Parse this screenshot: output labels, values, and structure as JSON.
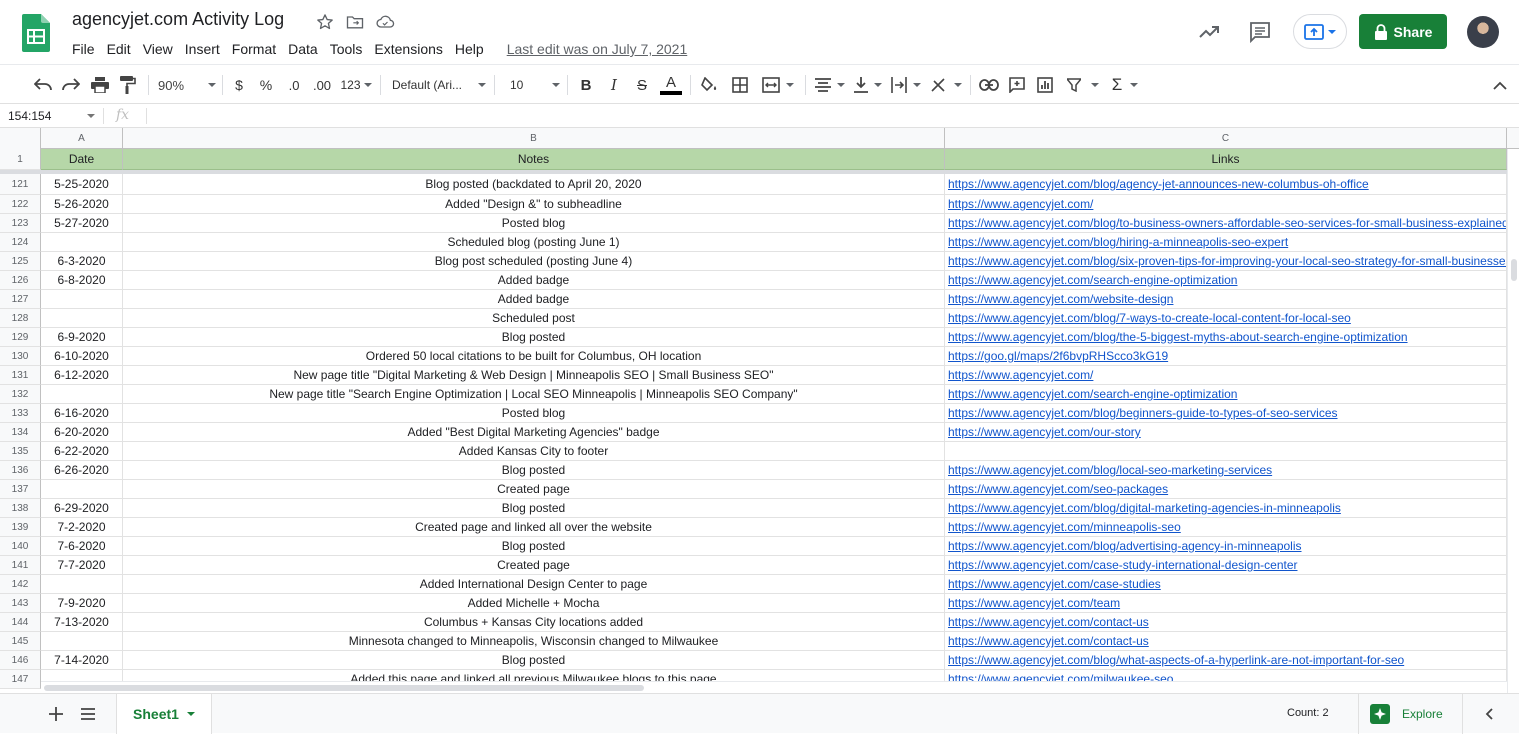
{
  "header": {
    "title": "agencyjet.com Activity Log",
    "menu": [
      "File",
      "Edit",
      "View",
      "Insert",
      "Format",
      "Data",
      "Tools",
      "Extensions",
      "Help"
    ],
    "last_edit": "Last edit was on July 7, 2021",
    "share_label": "Share",
    "brand_color": "#188038"
  },
  "toolbar": {
    "zoom": "90%",
    "currency": "$",
    "percent": "%",
    "decrease_decimal": ".0",
    "increase_decimal": ".00",
    "more_formats": "123",
    "font": "Default (Ari...",
    "font_size": "10"
  },
  "formula_bar": {
    "name_box": "154:154",
    "fx": "fx",
    "value": ""
  },
  "columns": [
    "A",
    "B",
    "C"
  ],
  "header_row": {
    "row": "1",
    "cells": [
      "Date",
      "Notes",
      "Links"
    ],
    "fill": "#b6d7a8"
  },
  "rows": [
    {
      "row": "121",
      "date": "5-25-2020",
      "note": "Blog posted (backdated to April 20, 2020",
      "link": "https://www.agencyjet.com/blog/agency-jet-announces-new-columbus-oh-office"
    },
    {
      "row": "122",
      "date": "5-26-2020",
      "note": "Added \"Design &\" to subheadline",
      "link": "https://www.agencyjet.com/"
    },
    {
      "row": "123",
      "date": "5-27-2020",
      "note": "Posted blog",
      "link": "https://www.agencyjet.com/blog/to-business-owners-affordable-seo-services-for-small-business-explained"
    },
    {
      "row": "124",
      "date": "",
      "note": "Scheduled blog (posting June 1)",
      "link": "https://www.agencyjet.com/blog/hiring-a-minneapolis-seo-expert"
    },
    {
      "row": "125",
      "date": "6-3-2020",
      "note": "Blog post scheduled (posting June 4)",
      "link": "https://www.agencyjet.com/blog/six-proven-tips-for-improving-your-local-seo-strategy-for-small-businesses"
    },
    {
      "row": "126",
      "date": "6-8-2020",
      "note": "Added badge",
      "link": "https://www.agencyjet.com/search-engine-optimization"
    },
    {
      "row": "127",
      "date": "",
      "note": "Added badge",
      "link": "https://www.agencyjet.com/website-design"
    },
    {
      "row": "128",
      "date": "",
      "note": "Scheduled post",
      "link": "https://www.agencyjet.com/blog/7-ways-to-create-local-content-for-local-seo"
    },
    {
      "row": "129",
      "date": "6-9-2020",
      "note": "Blog posted",
      "link": "https://www.agencyjet.com/blog/the-5-biggest-myths-about-search-engine-optimization"
    },
    {
      "row": "130",
      "date": "6-10-2020",
      "note": "Ordered 50 local citations to be built for Columbus, OH location",
      "link": "https://goo.gl/maps/2f6bvpRHScco3kG19"
    },
    {
      "row": "131",
      "date": "6-12-2020",
      "note": "New page title \"Digital Marketing & Web Design | Minneapolis SEO | Small Business SEO\"",
      "link": "https://www.agencyjet.com/"
    },
    {
      "row": "132",
      "date": "",
      "note": "New page title \"Search Engine Optimization | Local SEO Minneapolis | Minneapolis SEO Company\"",
      "link": "https://www.agencyjet.com/search-engine-optimization"
    },
    {
      "row": "133",
      "date": "6-16-2020",
      "note": "Posted blog",
      "link": "https://www.agencyjet.com/blog/beginners-guide-to-types-of-seo-services"
    },
    {
      "row": "134",
      "date": "6-20-2020",
      "note": "Added \"Best Digital Marketing Agencies\" badge",
      "link": "https://www.agencyjet.com/our-story"
    },
    {
      "row": "135",
      "date": "6-22-2020",
      "note": "Added Kansas City to footer",
      "link": ""
    },
    {
      "row": "136",
      "date": "6-26-2020",
      "note": "Blog posted",
      "link": "https://www.agencyjet.com/blog/local-seo-marketing-services"
    },
    {
      "row": "137",
      "date": "",
      "note": "Created page",
      "link": "https://www.agencyjet.com/seo-packages"
    },
    {
      "row": "138",
      "date": "6-29-2020",
      "note": "Blog posted",
      "link": "https://www.agencyjet.com/blog/digital-marketing-agencies-in-minneapolis"
    },
    {
      "row": "139",
      "date": "7-2-2020",
      "note": "Created page and linked all over the website",
      "link": "https://www.agencyjet.com/minneapolis-seo"
    },
    {
      "row": "140",
      "date": "7-6-2020",
      "note": "Blog posted",
      "link": "https://www.agencyjet.com/blog/advertising-agency-in-minneapolis"
    },
    {
      "row": "141",
      "date": "7-7-2020",
      "note": "Created page",
      "link": "https://www.agencyjet.com/case-study-international-design-center"
    },
    {
      "row": "142",
      "date": "",
      "note": "Added International Design Center to page",
      "link": "https://www.agencyjet.com/case-studies"
    },
    {
      "row": "143",
      "date": "7-9-2020",
      "note": "Added Michelle + Mocha",
      "link": "https://www.agencyjet.com/team"
    },
    {
      "row": "144",
      "date": "7-13-2020",
      "note": "Columbus + Kansas City locations added",
      "link": "https://www.agencyjet.com/contact-us"
    },
    {
      "row": "145",
      "date": "",
      "note": "Minnesota changed to Minneapolis, Wisconsin changed to Milwaukee",
      "link": "https://www.agencyjet.com/contact-us"
    },
    {
      "row": "146",
      "date": "7-14-2020",
      "note": "Blog posted",
      "link": "https://www.agencyjet.com/blog/what-aspects-of-a-hyperlink-are-not-important-for-seo"
    },
    {
      "row": "147",
      "date": "",
      "note": "Added this page and linked all previous Milwaukee blogs to this page",
      "link": "https://www.agencyjet.com/milwaukee-seo"
    }
  ],
  "bottom_bar": {
    "sheet_name": "Sheet1",
    "count": "Count: 2",
    "explore_label": "Explore"
  },
  "icons": [
    "sheets-logo-icon",
    "star-icon",
    "move-to-folder-icon",
    "cloud-saved-icon",
    "activity-trend-icon",
    "comments-icon",
    "present-icon",
    "lock-icon",
    "avatar",
    "undo-icon",
    "redo-icon",
    "print-icon",
    "paint-format-icon",
    "bold-icon",
    "italic-icon",
    "strikethrough-icon",
    "text-color-icon",
    "fill-color-icon",
    "borders-icon",
    "merge-icon",
    "align-icon",
    "valign-icon",
    "wrap-icon",
    "rotate-icon",
    "link-icon",
    "comment-icon",
    "chart-icon",
    "filter-icon",
    "functions-icon",
    "collapse-icon",
    "add-sheet-icon",
    "all-sheets-icon",
    "explore-icon"
  ]
}
